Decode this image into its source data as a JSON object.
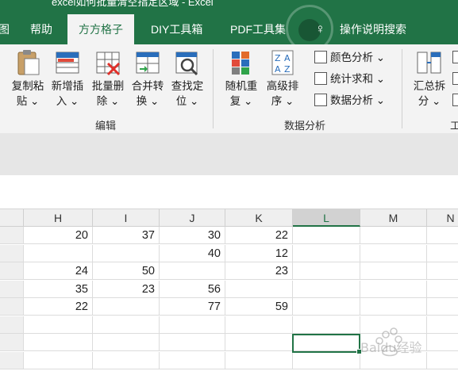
{
  "window": {
    "title": "excel如何批量清空指定区域 - Excel"
  },
  "tabs": [
    {
      "label": "图"
    },
    {
      "label": "帮助"
    },
    {
      "label": "方方格子"
    },
    {
      "label": "DIY工具箱"
    },
    {
      "label": "PDF工具集"
    },
    {
      "label": "操作说明搜索"
    }
  ],
  "ribbon": {
    "edit_buttons": [
      {
        "line1": "复制粘",
        "line2": "贴 ⌄"
      },
      {
        "line1": "新增插",
        "line2": "入 ⌄"
      },
      {
        "line1": "批量删",
        "line2": "除 ⌄"
      },
      {
        "line1": "合并转",
        "line2": "换 ⌄"
      },
      {
        "line1": "查找定",
        "line2": "位 ⌄"
      }
    ],
    "edit_group_label": "编辑",
    "analysis_buttons": [
      {
        "line1": "随机重",
        "line2": "复 ⌄"
      },
      {
        "line1": "高级排",
        "line2": "序 ⌄"
      }
    ],
    "analysis_small": [
      {
        "label": "颜色分析 ⌄"
      },
      {
        "label": "统计求和 ⌄"
      },
      {
        "label": "数据分析 ⌄"
      }
    ],
    "analysis_group_label": "数据分析",
    "summary_button": {
      "line1": "汇总拆",
      "line2": "分 ⌄"
    },
    "tools_group_label_partial": "工"
  },
  "sheet": {
    "columns": [
      "H",
      "I",
      "J",
      "K",
      "L",
      "M",
      "N"
    ],
    "selected_column": "L",
    "rows": [
      [
        "20",
        "37",
        "30",
        "22",
        "",
        "",
        ""
      ],
      [
        "",
        "",
        "40",
        "12",
        "",
        "",
        ""
      ],
      [
        "24",
        "50",
        "",
        "23",
        "",
        "",
        ""
      ],
      [
        "35",
        "23",
        "56",
        "",
        "",
        "",
        ""
      ],
      [
        "22",
        "",
        "77",
        "59",
        "",
        "",
        ""
      ],
      [
        "",
        "",
        "",
        "",
        "",
        "",
        ""
      ],
      [
        "",
        "",
        "",
        "",
        "",
        "",
        ""
      ],
      [
        "",
        "",
        "",
        "",
        "",
        "",
        ""
      ]
    ]
  },
  "watermark": {
    "text": "Baidu经验"
  },
  "colors": {
    "excel_green": "#217346",
    "ribbon_bg": "#f3f3f3"
  }
}
